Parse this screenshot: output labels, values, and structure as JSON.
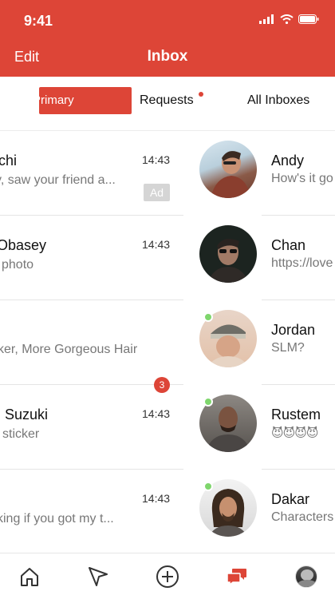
{
  "status_bar": {
    "time": "9:41"
  },
  "header": {
    "edit_label": "Edit",
    "title": "Inbox"
  },
  "tabs": [
    {
      "label": "Primary",
      "selected": true
    },
    {
      "label": "Requests",
      "has_unread_dot": true
    },
    {
      "label": "All Inboxes"
    }
  ],
  "left_conversations": [
    {
      "name": "chi",
      "time": "14:43",
      "preview": "y, saw your friend a..."
    },
    {
      "name": "Obasey",
      "time": "14:43",
      "preview": "photo"
    },
    {
      "name": "",
      "time": "",
      "preview": "ker, More Gorgeous Hair",
      "badge": "Ad"
    },
    {
      "name": "Suzuki",
      "time": "14:43",
      "preview": "sticker"
    },
    {
      "name": "",
      "time": "14:43",
      "preview": "king if you got my t...",
      "unread_count": "3"
    }
  ],
  "right_conversations": [
    {
      "name": "Andy",
      "preview": "How's it go",
      "online": false
    },
    {
      "name": "Chan",
      "preview": "https://love",
      "online": false
    },
    {
      "name": "Jordan",
      "preview": "SLM?",
      "online": true
    },
    {
      "name": "Rustem",
      "preview": "😈😈😈😈",
      "online": true
    },
    {
      "name": "Dakar",
      "preview": "Characters",
      "online": true
    }
  ],
  "bottom_nav": [
    {
      "icon": "home-icon"
    },
    {
      "icon": "send-icon"
    },
    {
      "icon": "add-circle-icon"
    },
    {
      "icon": "chat-bubbles-icon",
      "active": true
    },
    {
      "icon": "profile-avatar"
    }
  ],
  "colors": {
    "brand": "#dd4537",
    "online": "#7fd66d",
    "ad_badge": "#d5d5d5"
  }
}
